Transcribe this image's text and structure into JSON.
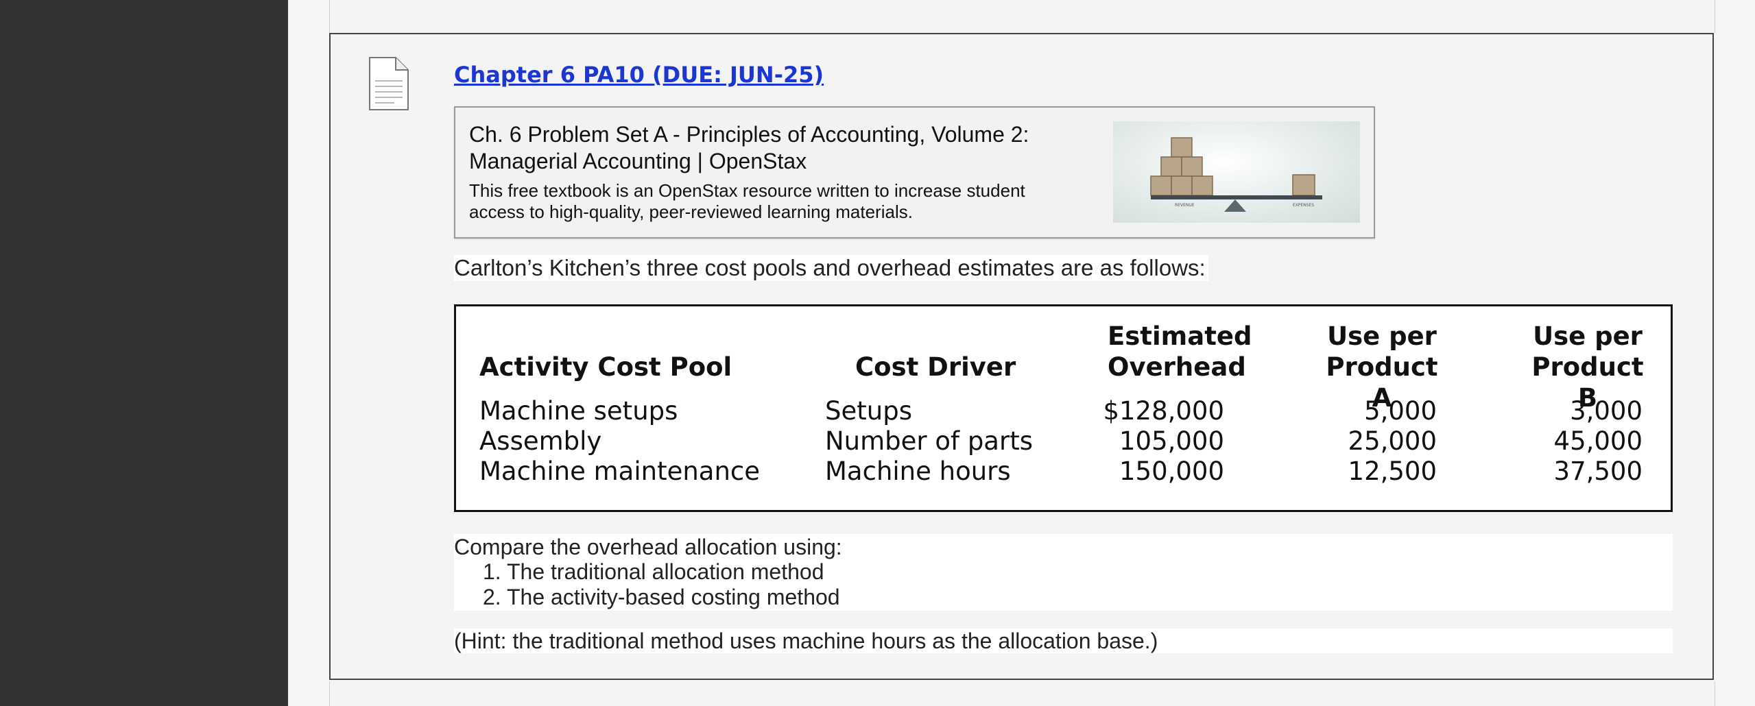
{
  "item": {
    "title": "Chapter 6 PA10 (DUE: JUN-25)"
  },
  "link_preview": {
    "title": "Ch. 6 Problem Set A - Principles of Accounting, Volume 2: Managerial Accounting | OpenStax",
    "description": "This free textbook is an OpenStax resource written to increase student access to high-quality, peer-reviewed learning materials.",
    "thumbnail_left_label": "REVENUE",
    "thumbnail_right_label": "EXPENSES"
  },
  "intro": "Carlton’s Kitchen’s three cost pools and overhead estimates are as follows:",
  "table": {
    "headers": {
      "pool": "Activity Cost Pool",
      "driver": "Cost Driver",
      "overhead_1": "Estimated",
      "overhead_2": "Overhead",
      "a_1": "Use per",
      "a_2": "Product A",
      "b_1": "Use per",
      "b_2": "Product B"
    },
    "rows": [
      {
        "pool": "Machine setups",
        "driver": "Setups",
        "overhead": "$128,000",
        "a": "5,000",
        "b": "3,000"
      },
      {
        "pool": "Assembly",
        "driver": "Number of parts",
        "overhead": "105,000",
        "a": "25,000",
        "b": "45,000"
      },
      {
        "pool": "Machine maintenance",
        "driver": "Machine hours",
        "overhead": "150,000",
        "a": "12,500",
        "b": "37,500"
      }
    ]
  },
  "compare": {
    "lead": "Compare the overhead allocation using:",
    "items": [
      "The traditional allocation method",
      "The activity-based costing method"
    ]
  },
  "hint": "(Hint: the traditional method uses machine hours as the allocation base.)"
}
